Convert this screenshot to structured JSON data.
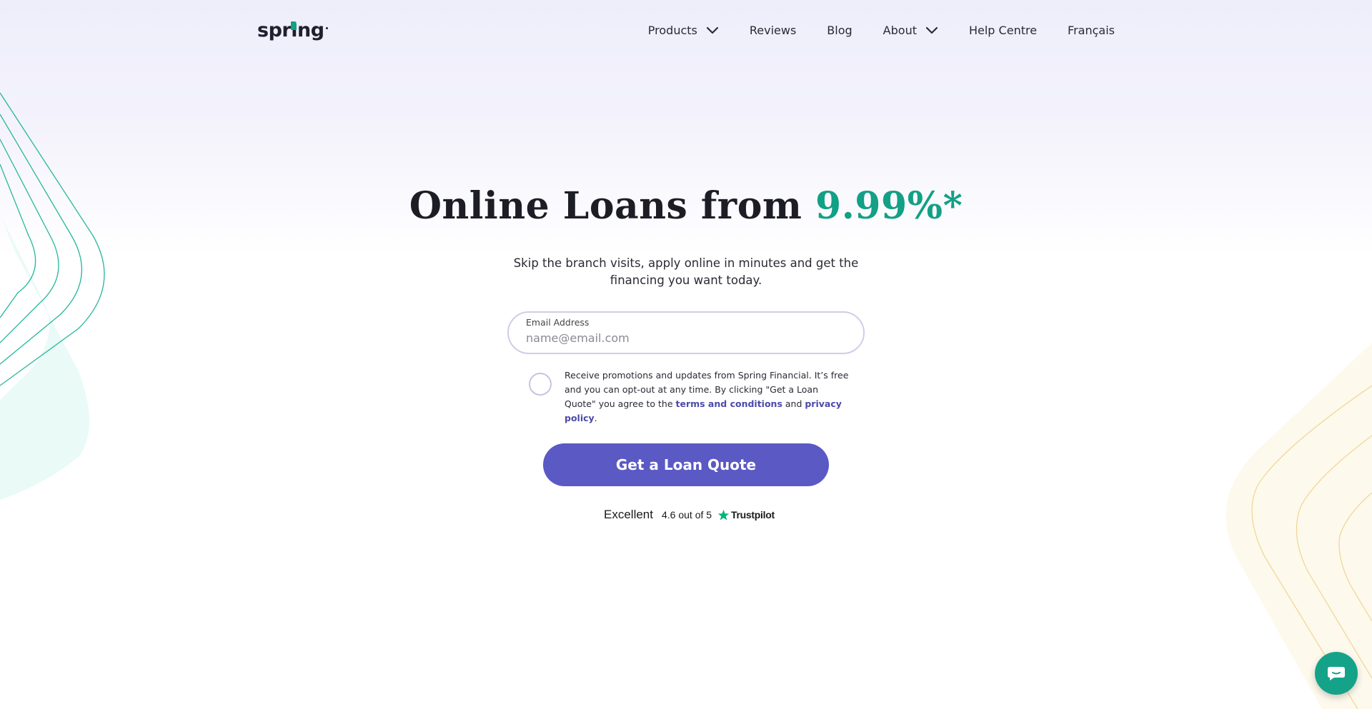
{
  "header": {
    "logo_text": "spring",
    "nav": [
      {
        "label": "Products",
        "has_dropdown": true
      },
      {
        "label": "Reviews",
        "has_dropdown": false
      },
      {
        "label": "Blog",
        "has_dropdown": false
      },
      {
        "label": "About",
        "has_dropdown": true
      },
      {
        "label": "Help Centre",
        "has_dropdown": false
      },
      {
        "label": "Français",
        "has_dropdown": false
      }
    ]
  },
  "hero": {
    "title_main": "Online Loans from ",
    "title_accent": "9.99%*",
    "subtitle": "Skip the branch visits, apply online in minutes and get the financing you want today."
  },
  "form": {
    "email_label": "Email Address",
    "email_placeholder": "name@email.com",
    "email_value": "",
    "consent_text_1": "Receive promotions and updates from Spring Financial. It’s free and you can opt-out at any time. By clicking \"Get a Loan Quote\" you agree to the ",
    "terms_link": "terms and conditions",
    "consent_and": " and ",
    "privacy_link": "privacy policy",
    "consent_end": ".",
    "consent_checked": false,
    "cta_label": "Get a Loan Quote"
  },
  "trustpilot": {
    "rating_word": "Excellent",
    "score_text": "4.6 out of 5",
    "brand": "Trustpilot"
  },
  "colors": {
    "accent_green": "#12a086",
    "button_purple": "#5b59c4",
    "link_purple": "#4b4aab",
    "chat_green": "#14a389"
  },
  "icons": {
    "dropdown": "chevron-down-icon",
    "trust_star": "star-icon",
    "chat": "chat-bubble-icon"
  }
}
